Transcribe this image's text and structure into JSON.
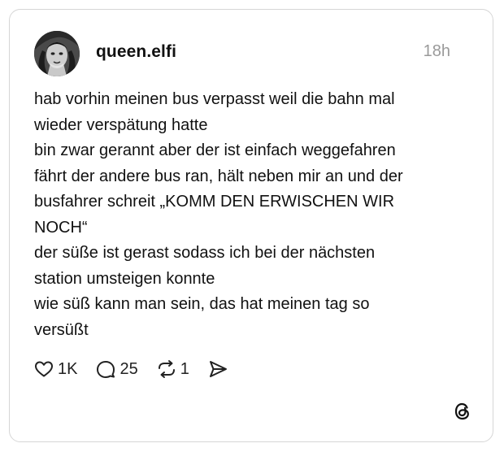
{
  "post": {
    "username": "queen.elfi",
    "timestamp": "18h",
    "lines": [
      "hab vorhin meinen bus verpasst weil die bahn mal",
      "wieder verspätung hatte",
      "bin zwar gerannt aber der ist einfach weggefahren",
      "fährt der andere bus ran, hält neben mir an und der",
      "busfahrer schreit „KOMM DEN ERWISCHEN WIR",
      "NOCH“",
      "der süße ist gerast sodass ich bei der nächsten",
      "station umsteigen konnte",
      "wie süß kann man sein, das hat meinen tag so",
      "versüßt"
    ]
  },
  "actions": {
    "like": {
      "icon": "heart-icon",
      "count": "1K"
    },
    "reply": {
      "icon": "comment-icon",
      "count": "25"
    },
    "repost": {
      "icon": "repost-icon",
      "count": "1"
    },
    "share": {
      "icon": "send-icon"
    }
  },
  "branding": {
    "icon": "threads-logo-icon"
  },
  "colors": {
    "text": "#111111",
    "timestamp": "#9a9a9a",
    "border": "#d6d6d6",
    "background": "#ffffff"
  }
}
